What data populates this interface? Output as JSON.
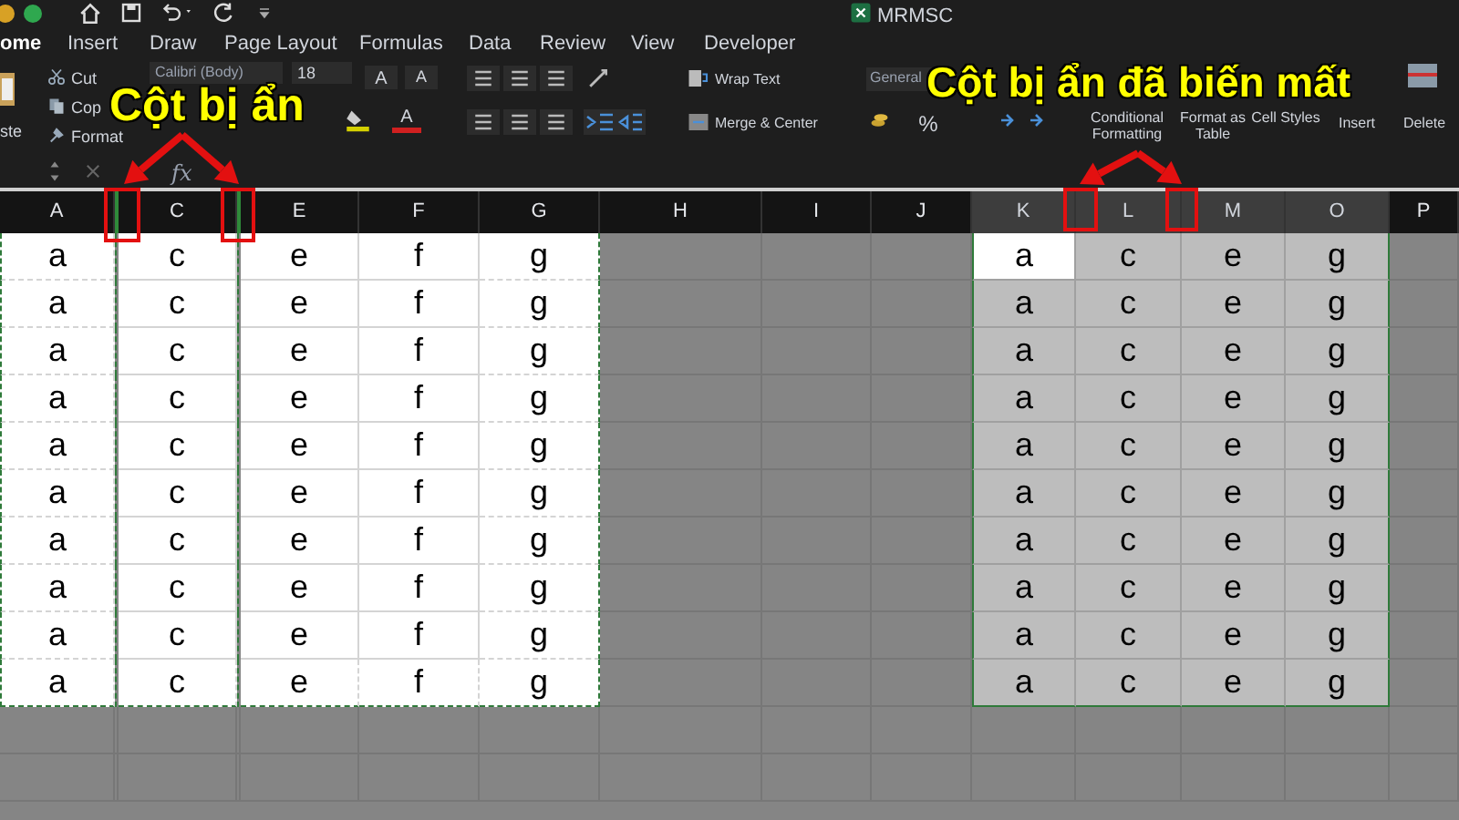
{
  "window": {
    "title": "MRMSC"
  },
  "ribbon_tabs": [
    {
      "label": "ome",
      "selected": true
    },
    {
      "label": "Insert",
      "selected": false
    },
    {
      "label": "Draw",
      "selected": false
    },
    {
      "label": "Page Layout",
      "selected": false
    },
    {
      "label": "Formulas",
      "selected": false
    },
    {
      "label": "Data",
      "selected": false
    },
    {
      "label": "Review",
      "selected": false
    },
    {
      "label": "View",
      "selected": false
    },
    {
      "label": "Developer",
      "selected": false
    }
  ],
  "clipboard": {
    "paste": "ste",
    "cut": "Cut",
    "copy": "Cop",
    "format": "Format"
  },
  "font": {
    "name": "Calibri (Body)",
    "size": "18",
    "grow": "A",
    "shrink": "A",
    "font_color_label": "A"
  },
  "alignment": {
    "wrap_text": "Wrap Text",
    "merge_center": "Merge & Center"
  },
  "number": {
    "format": "General",
    "percent": "%"
  },
  "styles": [
    "Conditional Formatting",
    "Format as Table",
    "Cell Styles"
  ],
  "cells_group": [
    "Insert",
    "Delete"
  ],
  "formula_bar": {
    "function_label": "fx"
  },
  "columns": [
    {
      "kind": "column",
      "label": "A",
      "selected": false
    },
    {
      "kind": "hidden"
    },
    {
      "kind": "column",
      "label": "C",
      "selected": false
    },
    {
      "kind": "hidden"
    },
    {
      "kind": "column",
      "label": "E",
      "selected": false
    },
    {
      "kind": "column",
      "label": "F",
      "selected": false
    },
    {
      "kind": "column",
      "label": "G",
      "selected": false
    },
    {
      "kind": "column",
      "label": "H",
      "selected": false
    },
    {
      "kind": "column",
      "label": "I",
      "selected": false
    },
    {
      "kind": "column",
      "label": "J",
      "selected": false
    },
    {
      "kind": "column",
      "label": "K",
      "selected": true
    },
    {
      "kind": "column",
      "label": "L",
      "selected": true
    },
    {
      "kind": "column",
      "label": "M",
      "selected": true
    },
    {
      "kind": "column",
      "label": "O",
      "selected": true
    },
    {
      "kind": "column",
      "label": "P",
      "selected": false
    }
  ],
  "copied_table": {
    "rows": [
      [
        "a",
        "c",
        "e",
        "f",
        "g"
      ],
      [
        "a",
        "c",
        "e",
        "f",
        "g"
      ],
      [
        "a",
        "c",
        "e",
        "f",
        "g"
      ],
      [
        "a",
        "c",
        "e",
        "f",
        "g"
      ],
      [
        "a",
        "c",
        "e",
        "f",
        "g"
      ],
      [
        "a",
        "c",
        "e",
        "f",
        "g"
      ],
      [
        "a",
        "c",
        "e",
        "f",
        "g"
      ],
      [
        "a",
        "c",
        "e",
        "f",
        "g"
      ],
      [
        "a",
        "c",
        "e",
        "f",
        "g"
      ],
      [
        "a",
        "c",
        "e",
        "f",
        "g"
      ]
    ]
  },
  "selected_table": {
    "rows": [
      [
        {
          "text": "a",
          "active": true
        },
        {
          "text": "c",
          "active": false
        },
        {
          "text": "e",
          "active": false
        },
        {
          "text": "g",
          "active": false
        }
      ],
      [
        {
          "text": "a",
          "active": false
        },
        {
          "text": "c",
          "active": false
        },
        {
          "text": "e",
          "active": false
        },
        {
          "text": "g",
          "active": false
        }
      ],
      [
        {
          "text": "a",
          "active": false
        },
        {
          "text": "c",
          "active": false
        },
        {
          "text": "e",
          "active": false
        },
        {
          "text": "g",
          "active": false
        }
      ],
      [
        {
          "text": "a",
          "active": false
        },
        {
          "text": "c",
          "active": false
        },
        {
          "text": "e",
          "active": false
        },
        {
          "text": "g",
          "active": false
        }
      ],
      [
        {
          "text": "a",
          "active": false
        },
        {
          "text": "c",
          "active": false
        },
        {
          "text": "e",
          "active": false
        },
        {
          "text": "g",
          "active": false
        }
      ],
      [
        {
          "text": "a",
          "active": false
        },
        {
          "text": "c",
          "active": false
        },
        {
          "text": "e",
          "active": false
        },
        {
          "text": "g",
          "active": false
        }
      ],
      [
        {
          "text": "a",
          "active": false
        },
        {
          "text": "c",
          "active": false
        },
        {
          "text": "e",
          "active": false
        },
        {
          "text": "g",
          "active": false
        }
      ],
      [
        {
          "text": "a",
          "active": false
        },
        {
          "text": "c",
          "active": false
        },
        {
          "text": "e",
          "active": false
        },
        {
          "text": "g",
          "active": false
        }
      ],
      [
        {
          "text": "a",
          "active": false
        },
        {
          "text": "c",
          "active": false
        },
        {
          "text": "e",
          "active": false
        },
        {
          "text": "g",
          "active": false
        }
      ],
      [
        {
          "text": "a",
          "active": false
        },
        {
          "text": "c",
          "active": false
        },
        {
          "text": "e",
          "active": false
        },
        {
          "text": "g",
          "active": false
        }
      ]
    ]
  },
  "annotations": [
    {
      "text": "Cột bị ẩn"
    },
    {
      "text": "Cột bị ẩn đã biến mất"
    }
  ]
}
